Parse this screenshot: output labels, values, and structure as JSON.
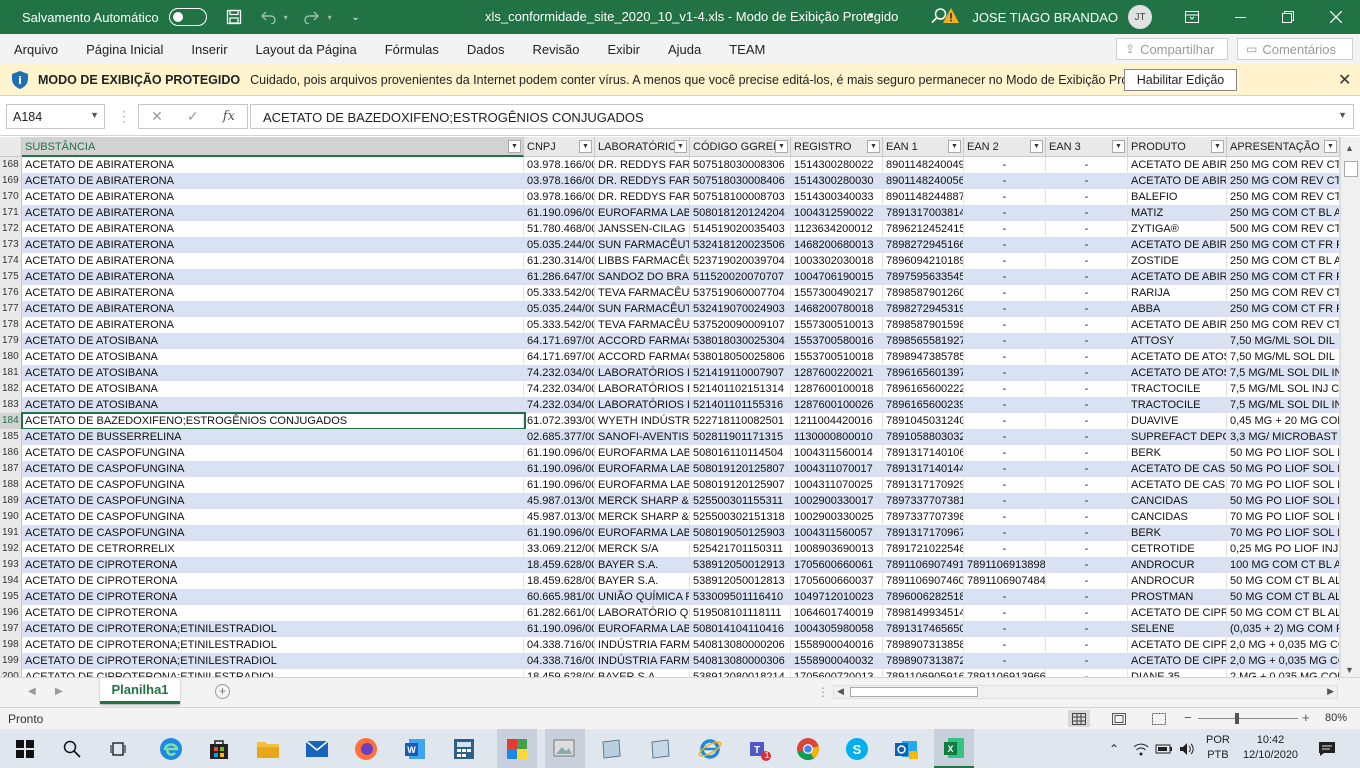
{
  "titlebar": {
    "autosave_label": "Salvamento Automático",
    "doc_title": "xls_conformidade_site_2020_10_v1-4.xls  -  Modo de Exibição Protegido",
    "user_name": "JOSE TIAGO BRANDAO",
    "user_initials": "JT"
  },
  "menu": {
    "items": [
      "Arquivo",
      "Página Inicial",
      "Inserir",
      "Layout da Página",
      "Fórmulas",
      "Dados",
      "Revisão",
      "Exibir",
      "Ajuda",
      "TEAM"
    ],
    "share": "Compartilhar",
    "comments": "Comentários"
  },
  "protected": {
    "title": "MODO DE EXIBIÇÃO PROTEGIDO",
    "message": "Cuidado, pois arquivos provenientes da Internet podem conter vírus. A menos que você precise editá-los, é mais seguro permanecer no Modo de  Exibição Protegido.",
    "enable_button": "Habilitar Edição"
  },
  "formula": {
    "name_box": "A184",
    "fx": "fx",
    "content": "ACETATO DE BAZEDOXIFENO;ESTROGÊNIOS CONJUGADOS"
  },
  "columns": [
    "SUBSTÂNCIA",
    "CNPJ",
    "LABORATÓRIO",
    "CÓDIGO GGREM",
    "REGISTRO",
    "EAN 1",
    "EAN 2",
    "EAN 3",
    "PRODUTO",
    "APRESENTAÇÃO"
  ],
  "rows": [
    {
      "n": "168",
      "c": [
        "ACETATO DE ABIRATERONA",
        "03.978.166/00",
        "DR. REDDYS FARM",
        "507518030008306",
        "1514300280022",
        "8901148240049",
        "-",
        "-",
        "ACETATO DE ABIRA",
        "250 MG COM REV CT"
      ]
    },
    {
      "n": "169",
      "c": [
        "ACETATO DE ABIRATERONA",
        "03.978.166/00",
        "DR. REDDYS FARM",
        "507518030008406",
        "1514300280030",
        "8901148240056",
        "-",
        "-",
        "ACETATO DE ABIRA",
        "250 MG COM REV CT"
      ]
    },
    {
      "n": "170",
      "c": [
        "ACETATO DE ABIRATERONA",
        "03.978.166/00",
        "DR. REDDYS FARM",
        "507518100008703",
        "1514300340033",
        "8901148244887",
        "-",
        "-",
        "BALEFIO",
        "250 MG COM REV CT"
      ]
    },
    {
      "n": "171",
      "c": [
        "ACETATO DE ABIRATERONA",
        "61.190.096/00",
        "EUROFARMA LABO",
        "508018120124204",
        "1004312590022",
        "7891317003814",
        "-",
        "-",
        "MATIZ",
        "250 MG COM CT BL AL"
      ]
    },
    {
      "n": "172",
      "c": [
        "ACETATO DE ABIRATERONA",
        "51.780.468/00",
        "JANSSEN-CILAG FA",
        "514519020035403",
        "1123634200012",
        "7896212452415",
        "-",
        "-",
        "ZYTIGA®",
        "500 MG COM REV CT"
      ]
    },
    {
      "n": "173",
      "c": [
        "ACETATO DE ABIRATERONA",
        "05.035.244/00",
        "SUN FARMACÊUTI",
        "532418120023506",
        "1468200680013",
        "7898272945166",
        "-",
        "-",
        "ACETATO DE ABIRA",
        "250 MG COM CT FR PL"
      ]
    },
    {
      "n": "174",
      "c": [
        "ACETATO DE ABIRATERONA",
        "61.230.314/00",
        "LIBBS FARMACÊUT",
        "523719020039704",
        "1003302030018",
        "7896094210189",
        "-",
        "-",
        "ZOSTIDE",
        "250 MG COM CT BL AL"
      ]
    },
    {
      "n": "175",
      "c": [
        "ACETATO DE ABIRATERONA",
        "61.286.647/00",
        "SANDOZ DO BRAS",
        "511520020070707",
        "1004706190015",
        "7897595633545",
        "-",
        "-",
        "ACETATO DE ABIRA",
        "250 MG COM CT FR PL"
      ]
    },
    {
      "n": "176",
      "c": [
        "ACETATO DE ABIRATERONA",
        "05.333.542/00",
        "TEVA FARMACÊUT",
        "537519060007704",
        "1557300490217",
        "7898587901260",
        "-",
        "-",
        "RARIJA",
        "250 MG COM REV CT"
      ]
    },
    {
      "n": "177",
      "c": [
        "ACETATO DE ABIRATERONA",
        "05.035.244/00",
        "SUN FARMACÊUTI",
        "532419070024903",
        "1468200780018",
        "7898272945319",
        "-",
        "-",
        "ABBA",
        "250 MG COM CT FR PL"
      ]
    },
    {
      "n": "178",
      "c": [
        "ACETATO DE ABIRATERONA",
        "05.333.542/00",
        "TEVA FARMACÊUT",
        "537520090009107",
        "1557300510013",
        "7898587901598",
        "-",
        "-",
        "ACETATO DE ABIRA",
        "250 MG COM REV CT"
      ]
    },
    {
      "n": "179",
      "c": [
        "ACETATO DE ATOSIBANA",
        "64.171.697/00",
        "ACCORD FARMACÊ",
        "538018030025304",
        "1553700580016",
        "7898565581927",
        "-",
        "-",
        "ATTOSY",
        "7,50 MG/ML SOL DIL"
      ]
    },
    {
      "n": "180",
      "c": [
        "ACETATO DE ATOSIBANA",
        "64.171.697/00",
        "ACCORD FARMACÊ",
        "538018050025806",
        "1553700510018",
        "7898947385785",
        "-",
        "-",
        "ACETATO DE ATOSI",
        "7,50 MG/ML SOL DIL"
      ]
    },
    {
      "n": "181",
      "c": [
        "ACETATO DE ATOSIBANA",
        "74.232.034/00",
        "LABORATÓRIOS FE",
        "521419110007907",
        "1287600220021",
        "7896165601397",
        "-",
        "-",
        "ACETATO DE ATOSI",
        "7,5 MG/ML SOL DIL IN"
      ]
    },
    {
      "n": "182",
      "c": [
        "ACETATO DE ATOSIBANA",
        "74.232.034/00",
        "LABORATÓRIOS FE",
        "521401102151314",
        "1287600100018",
        "7896165600222",
        "-",
        "-",
        "TRACTOCILE",
        "7,5 MG/ML SOL INJ CT"
      ]
    },
    {
      "n": "183",
      "c": [
        "ACETATO DE ATOSIBANA",
        "74.232.034/00",
        "LABORATÓRIOS FE",
        "521401101155316",
        "1287600100026",
        "7896165600239",
        "-",
        "-",
        "TRACTOCILE",
        "7,5 MG/ML SOL DIL IN"
      ]
    },
    {
      "n": "184",
      "c": [
        "ACETATO DE BAZEDOXIFENO;ESTROGÊNIOS CONJUGADOS",
        "61.072.393/00",
        "WYETH INDÚSTRI",
        "522718110082501",
        "1211004420016",
        "7891045031240",
        "-",
        "-",
        "DUAVIVE",
        "0,45 MG + 20 MG COM"
      ]
    },
    {
      "n": "185",
      "c": [
        "ACETATO DE BUSSERRELINA",
        "02.685.377/00",
        "SANOFI-AVENTIS F",
        "502811901171315",
        "1130000800010",
        "7891058803032",
        "-",
        "-",
        "SUPREFACT DEPOT",
        "3,3 MG/ MICROBAST"
      ]
    },
    {
      "n": "186",
      "c": [
        "ACETATO DE CASPOFUNGINA",
        "61.190.096/00",
        "EUROFARMA LABO",
        "508016110114504",
        "1004311560014",
        "7891317140106",
        "-",
        "-",
        "BERK",
        "50 MG PO LIOF SOL IN"
      ]
    },
    {
      "n": "187",
      "c": [
        "ACETATO DE CASPOFUNGINA",
        "61.190.096/00",
        "EUROFARMA LABO",
        "508019120125807",
        "1004311070017",
        "7891317140144",
        "-",
        "-",
        "ACETATO DE CASPO",
        "50 MG PO LIOF SOL IN"
      ]
    },
    {
      "n": "188",
      "c": [
        "ACETATO DE CASPOFUNGINA",
        "61.190.096/00",
        "EUROFARMA LABO",
        "508019120125907",
        "1004311070025",
        "7891317170929",
        "-",
        "-",
        "ACETATO DE CASPO",
        "70 MG PO LIOF SOL IN"
      ]
    },
    {
      "n": "189",
      "c": [
        "ACETATO DE CASPOFUNGINA",
        "45.987.013/00",
        "MERCK SHARP & D",
        "525500301155311",
        "1002900330017",
        "7897337707381",
        "-",
        "-",
        "CANCIDAS",
        "50 MG PO LIOF SOL IN"
      ]
    },
    {
      "n": "190",
      "c": [
        "ACETATO DE CASPOFUNGINA",
        "45.987.013/00",
        "MERCK SHARP & D",
        "525500302151318",
        "1002900330025",
        "7897337707398",
        "-",
        "-",
        "CANCIDAS",
        "70 MG PO LIOF SOL IN"
      ]
    },
    {
      "n": "191",
      "c": [
        "ACETATO DE CASPOFUNGINA",
        "61.190.096/00",
        "EUROFARMA LABO",
        "508019050125903",
        "1004311560057",
        "7891317170967",
        "-",
        "-",
        "BERK",
        "70 MG PO LIOF SOL IN"
      ]
    },
    {
      "n": "192",
      "c": [
        "ACETATO DE CETRORRELIX",
        "33.069.212/00",
        "MERCK S/A",
        "525421701150311",
        "1008903690013",
        "7891721022548",
        "-",
        "-",
        "CETROTIDE",
        "0,25 MG PO LIOF INJ C"
      ]
    },
    {
      "n": "193",
      "c": [
        "ACETATO DE CIPROTERONA",
        "18.459.628/00",
        "BAYER S.A.",
        "538912050012913",
        "1705600660061",
        "7891106907491",
        "7891106913898",
        "-",
        "ANDROCUR",
        "100 MG COM CT BL AL"
      ]
    },
    {
      "n": "194",
      "c": [
        "ACETATO DE CIPROTERONA",
        "18.459.628/00",
        "BAYER S.A.",
        "538912050012813",
        "1705600660037",
        "7891106907460",
        "7891106907484",
        "-",
        "ANDROCUR",
        "50 MG COM CT BL AL"
      ]
    },
    {
      "n": "195",
      "c": [
        "ACETATO DE CIPROTERONA",
        "60.665.981/00",
        "UNIÃO QUÍMICA F",
        "533009501116410",
        "1049712010023",
        "7896006282518",
        "-",
        "-",
        "PROSTMAN",
        "50 MG COM CT BL AL"
      ]
    },
    {
      "n": "196",
      "c": [
        "ACETATO DE CIPROTERONA",
        "61.282.661/00",
        "LABORATÓRIO QU",
        "519508101118111",
        "1064601740019",
        "7898149934514",
        "-",
        "-",
        "ACETATO DE CIPRO",
        "50 MG COM CT BL AL"
      ]
    },
    {
      "n": "197",
      "c": [
        "ACETATO DE CIPROTERONA;ETINILESTRADIOL",
        "61.190.096/00",
        "EUROFARMA LABO",
        "508014104110416",
        "1004305980058",
        "7891317465650",
        "-",
        "-",
        "SELENE",
        "(0,035 + 2) MG COM R"
      ]
    },
    {
      "n": "198",
      "c": [
        "ACETATO DE CIPROTERONA;ETINILESTRADIOL",
        "04.338.716/00",
        "INDÚSTRIA FARMA",
        "540813080000206",
        "1558900040016",
        "7898907313858",
        "-",
        "-",
        "ACETATO DE CIPRO",
        "2,0 MG + 0,035 MG CO"
      ]
    },
    {
      "n": "199",
      "c": [
        "ACETATO DE CIPROTERONA;ETINILESTRADIOL",
        "04.338.716/00",
        "INDÚSTRIA FARMA",
        "540813080000306",
        "1558900040032",
        "7898907313872",
        "-",
        "-",
        "ACETATO DE CIPRO",
        "2,0 MG + 0,035 MG CO"
      ]
    },
    {
      "n": "200",
      "c": [
        "ACETATO DE CIPROTERONA;ETINILESTRADIOL",
        "18.459.628/00",
        "BAYER S.A.",
        "538912080018214",
        "1705600720013",
        "7891106905916",
        "7891106913966",
        "-",
        "DIANE 35",
        "2 MG + 0,035 MG COM"
      ]
    }
  ],
  "sheet_tab": "Planilha1",
  "status": {
    "text": "Pronto",
    "zoom": "80%",
    "zoom_level_percent": 80
  },
  "taskbar": {
    "lang1": "POR",
    "lang2": "PTB",
    "time": "10:42",
    "date": "12/10/2020",
    "badge": "1"
  },
  "colors": {
    "excel_green": "#217346",
    "band": "#d9e1f2",
    "warning_bar": "#fff4ce"
  }
}
